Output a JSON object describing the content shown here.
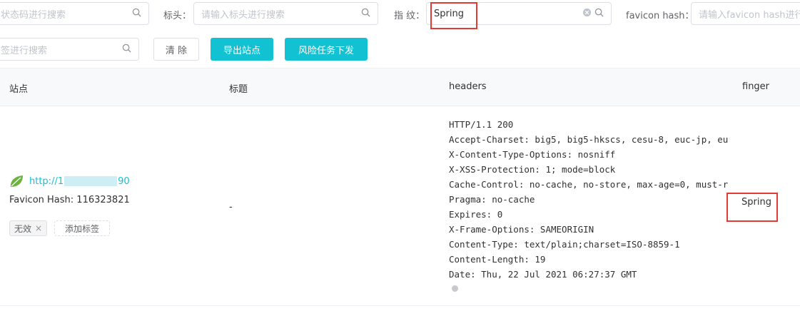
{
  "filters": {
    "status_placeholder": "状态码进行搜索",
    "title_label": "标头：",
    "title_placeholder": "请输入标头进行搜索",
    "finger_label": "指 纹：",
    "finger_value": "Spring",
    "favicon_label": "favicon hash：",
    "favicon_placeholder": "请输入favicon hash进行搜索",
    "tag_placeholder": "签进行搜索"
  },
  "buttons": {
    "clear": "清 除",
    "export": "导出站点",
    "risk_task": "风险任务下发"
  },
  "table": {
    "headers": [
      "站点",
      "标题",
      "headers",
      "finger"
    ],
    "row": {
      "url": "http://1",
      "url_tail": "90",
      "favicon_hash": "Favicon Hash: 116323821",
      "tag": "无效",
      "add_tag": "添加标签",
      "title": "-",
      "headers_lines": [
        "HTTP/1.1 200",
        "Accept-Charset: big5, big5-hkscs, cesu-8, euc-jp, eu",
        "X-Content-Type-Options: nosniff",
        "X-XSS-Protection: 1; mode=block",
        "Cache-Control: no-cache, no-store, max-age=0, must-r",
        "Pragma: no-cache",
        "Expires: 0",
        "X-Frame-Options: SAMEORIGIN",
        "Content-Type: text/plain;charset=ISO-8859-1",
        "Content-Length: 19",
        "Date: Thu, 22 Jul 2021 06:27:37 GMT"
      ],
      "finger": "Spring"
    }
  },
  "icons": {
    "search": "search-icon",
    "clear": "clear-icon",
    "leaf": "spring-leaf-icon",
    "close": "close-icon"
  },
  "colors": {
    "primary": "#13c2d2",
    "highlight": "#e53935",
    "link": "#13c2d2"
  }
}
